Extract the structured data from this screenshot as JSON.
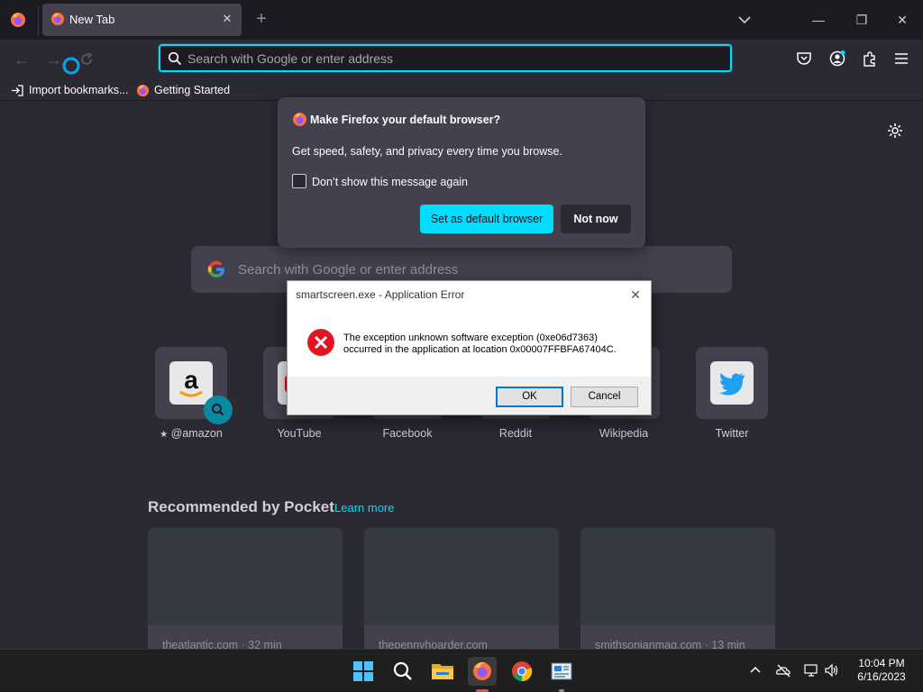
{
  "browser": {
    "tab": {
      "title": "New Tab"
    },
    "urlbar": {
      "placeholder": "Search with Google or enter address"
    },
    "bookmarks": [
      {
        "label": "Import bookmarks...",
        "icon": "import-icon"
      },
      {
        "label": "Getting Started",
        "icon": "firefox-icon"
      }
    ]
  },
  "newtab": {
    "search_placeholder": "Search with Google or enter address",
    "top_sites": [
      {
        "label": "@amazon",
        "icon": "amazon-icon",
        "pinned": true
      },
      {
        "label": "YouTube",
        "icon": "youtube-icon"
      },
      {
        "label": "Facebook",
        "icon": "facebook-icon"
      },
      {
        "label": "Reddit",
        "icon": "reddit-icon"
      },
      {
        "label": "Wikipedia",
        "icon": "wikipedia-icon"
      },
      {
        "label": "Twitter",
        "icon": "twitter-icon"
      }
    ],
    "pocket": {
      "title": "Recommended by Pocket",
      "learn_more": "Learn more",
      "cards": [
        {
          "source": "theatlantic.com · 32 min"
        },
        {
          "source": "thepennyhoarder.com"
        },
        {
          "source": "smithsonianmag.com · 13 min"
        }
      ]
    }
  },
  "default_prompt": {
    "title": "Make Firefox your default browser?",
    "body": "Get speed, safety, and privacy every time you browse.",
    "checkbox_label": "Don’t show this message again",
    "checkbox_checked": false,
    "primary_button": "Set as default browser",
    "secondary_button": "Not now"
  },
  "error_dialog": {
    "title": "smartscreen.exe - Application Error",
    "message_line1": "The exception unknown software exception (0xe06d7363)",
    "message_line2": "occurred in the application at location 0x00007FFBFA67404C.",
    "ok": "OK",
    "cancel": "Cancel"
  },
  "taskbar": {
    "apps": [
      "start-icon",
      "search-icon",
      "file-explorer-icon",
      "firefox-icon",
      "chrome-icon",
      "app-icon"
    ],
    "active_app": "firefox-icon",
    "time": "10:04 PM",
    "date": "6/16/2023"
  },
  "colors": {
    "accent": "#00ddff",
    "toolbar": "#2b2a33",
    "tabstrip": "#1c1b22",
    "error_red": "#e81123"
  }
}
